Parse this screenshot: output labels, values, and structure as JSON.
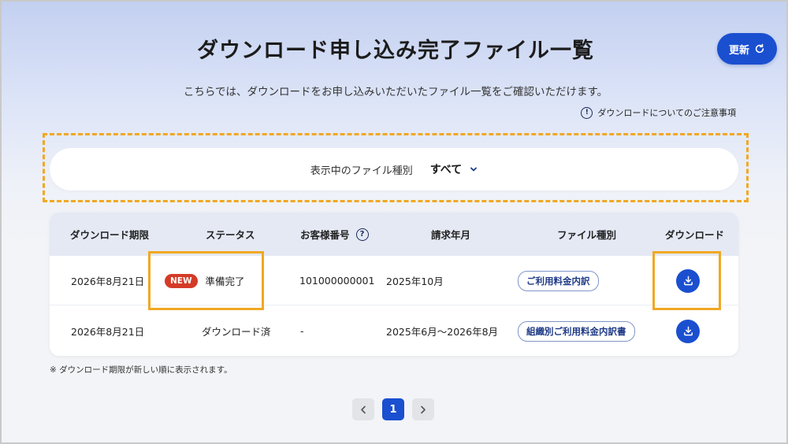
{
  "header": {
    "title": "ダウンロード申し込み完了ファイル一覧",
    "refresh_label": "更新",
    "subtitle": "こちらでは、ダウンロードをお申し込みいただいたファイル一覧をご確認いただけます。",
    "notice_label": "ダウンロードについてのご注意事項"
  },
  "filter": {
    "label": "表示中のファイル種別",
    "selected": "すべて"
  },
  "table": {
    "columns": [
      "ダウンロード期限",
      "ステータス",
      "お客様番号",
      "請求年月",
      "ファイル種別",
      "ダウンロード"
    ],
    "rows": [
      {
        "deadline": "2026年8月21日",
        "badge": "NEW",
        "status": "準備完了",
        "customer_no": "101000000001",
        "billing": "2025年10月",
        "file_type": "ご利用料金内訳"
      },
      {
        "deadline": "2026年8月21日",
        "badge": "",
        "status": "ダウンロード済",
        "customer_no": "-",
        "billing": "2025年6月～2026年8月",
        "file_type": "組織別ご利用料金内訳書"
      }
    ]
  },
  "footnote": "※ ダウンロード期限が新しい順に表示されます。",
  "pagination": {
    "current": "1"
  },
  "icons": {
    "refresh": "refresh-icon",
    "info": "info-icon",
    "help": "help-icon",
    "chevron": "chevron-down-icon",
    "download": "download-icon"
  },
  "colors": {
    "primary": "#1a4fd0",
    "badge": "#d43b27",
    "highlight": "#f1a823"
  }
}
